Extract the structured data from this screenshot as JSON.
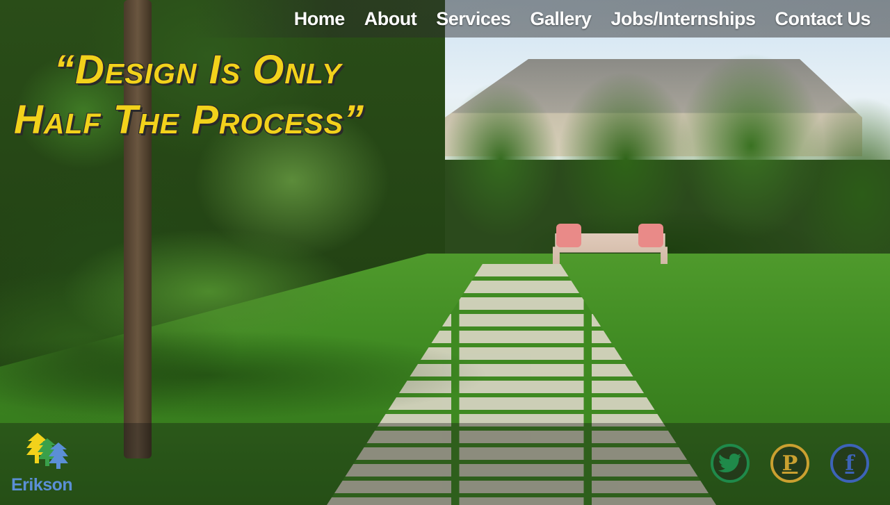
{
  "nav": {
    "items": [
      {
        "label": "Home"
      },
      {
        "label": "About"
      },
      {
        "label": "Services"
      },
      {
        "label": "Gallery"
      },
      {
        "label": "Jobs/Internships"
      },
      {
        "label": "Contact Us"
      }
    ]
  },
  "hero": {
    "headline_line1": "“Design Is Only",
    "headline_line2": "Half The Process”"
  },
  "footer": {
    "logo_text": "Erikson",
    "social": [
      {
        "icon": "twitter-icon",
        "glyph": "🐦"
      },
      {
        "icon": "pinterest-icon",
        "glyph": "P"
      },
      {
        "icon": "facebook-icon",
        "glyph": "f"
      }
    ]
  },
  "colors": {
    "headline": "#f2d21b",
    "logo_text": "#5b8fd6",
    "twitter": "#1f8a4a",
    "pinterest": "#caa030",
    "facebook": "#3d63b8"
  }
}
